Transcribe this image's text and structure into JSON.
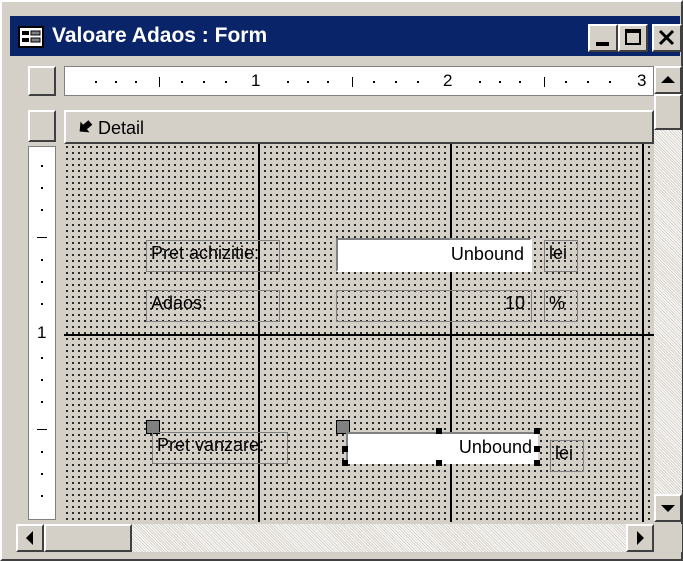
{
  "window": {
    "title": "Valoare Adaos : Form"
  },
  "ruler": {
    "numbers": [
      "1",
      "2",
      "3"
    ],
    "vertical_numbers": [
      "1"
    ]
  },
  "section": {
    "label": "Detail"
  },
  "controls": {
    "pret_achizitie_label": "Pret achizitie:",
    "pret_achizitie_value": "Unbound",
    "pret_achizitie_unit": "lei",
    "adaos_label": "Adaos:",
    "adaos_value": "10",
    "adaos_unit": "%",
    "pret_vanzare_label": "Pret vanzare:",
    "pret_vanzare_value": "Unbound",
    "pret_vanzare_unit": "lei"
  },
  "icons": {
    "app": "form-icon",
    "section": "section-arrow-icon",
    "minimize": "minimize-icon",
    "maximize": "maximize-icon",
    "close": "close-icon",
    "scroll_up": "arrow-up-icon",
    "scroll_down": "arrow-down-icon",
    "scroll_left": "arrow-left-icon",
    "scroll_right": "arrow-right-icon"
  },
  "colors": {
    "titlebar": "#0a246a",
    "face": "#d4d0c8"
  }
}
